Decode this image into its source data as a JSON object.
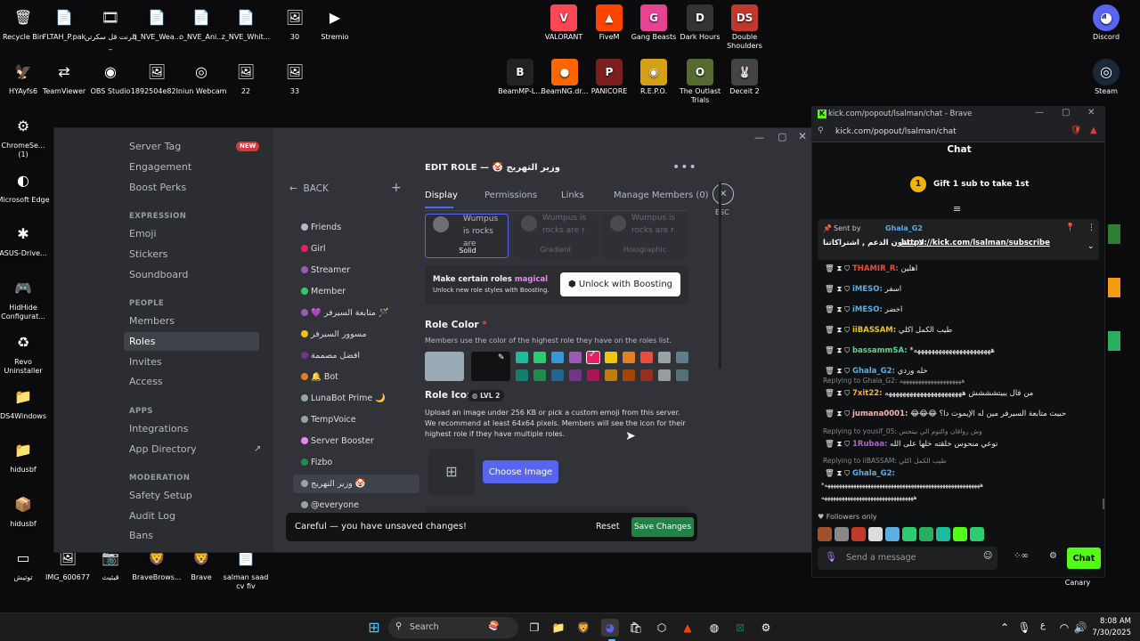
{
  "desktop": {
    "left_icons": [
      {
        "label": "Recycle Bin",
        "glyph": "🗑"
      },
      {
        "label": "FLTAH_P.pak",
        "glyph": "📄"
      },
      {
        "label": "الرنت قل سكرتن _",
        "glyph": "🎞"
      },
      {
        "label": "q_NVE_Wea...",
        "glyph": "📄"
      },
      {
        "label": "o_NVE_Ani...",
        "glyph": "📄"
      },
      {
        "label": "z_NVE_Whit...",
        "glyph": "📄"
      },
      {
        "label": "30",
        "glyph": "🖼"
      },
      {
        "label": "Stremio",
        "glyph": "▶"
      },
      {
        "label": "HYAyfs6",
        "glyph": "🦅"
      },
      {
        "label": "TeamViewer",
        "glyph": "⇄"
      },
      {
        "label": "OBS Studio",
        "glyph": "◉"
      },
      {
        "label": "1892504e82...",
        "glyph": "🖼"
      },
      {
        "label": "Iniun Webcam",
        "glyph": "◎"
      },
      {
        "label": "22",
        "glyph": "🖼"
      },
      {
        "label": "33",
        "glyph": "🖼"
      },
      {
        "label": "ChromeSe... (1)",
        "glyph": "⚙"
      },
      {
        "label": "Microsoft Edge",
        "glyph": "◐"
      },
      {
        "label": "ASUS-Drive...",
        "glyph": "✱"
      },
      {
        "label": "HidHide Configurat...",
        "glyph": "🎮"
      },
      {
        "label": "Revo Uninstaller",
        "glyph": "♻"
      },
      {
        "label": "DS4Windows",
        "glyph": "📁"
      },
      {
        "label": "hidusbf",
        "glyph": "📁"
      },
      {
        "label": "hidusbf",
        "glyph": "📦"
      },
      {
        "label": "توتيش",
        "glyph": "▭"
      },
      {
        "label": "IMG_600677",
        "glyph": "🖼"
      },
      {
        "label": "قيثيث",
        "glyph": "📷"
      },
      {
        "label": "BraveBrows...",
        "glyph": "🦁"
      },
      {
        "label": "Brave",
        "glyph": "🦁"
      },
      {
        "label": "salman saad cv fiv",
        "glyph": "📄"
      }
    ],
    "top_icons": [
      {
        "label": "VALORANT",
        "glyph": "V",
        "color": "#ff4655"
      },
      {
        "label": "FiveM",
        "glyph": "▲",
        "color": "#f40"
      },
      {
        "label": "Gang Beasts",
        "glyph": "G",
        "color": "#e84393"
      },
      {
        "label": "Dark Hours",
        "glyph": "D",
        "color": "#333"
      },
      {
        "label": "Double Shoulders",
        "glyph": "DS",
        "color": "#c0392b"
      },
      {
        "label": "BeamMP-L...",
        "glyph": "B",
        "color": "#222"
      },
      {
        "label": "BeamNG.dr...",
        "glyph": "●",
        "color": "#f60"
      },
      {
        "label": "PANICORE",
        "glyph": "P",
        "color": "#7b1e1e"
      },
      {
        "label": "R.E.P.O.",
        "glyph": "◉",
        "color": "#d4a017"
      },
      {
        "label": "The Outlast Trials",
        "glyph": "O",
        "color": "#556b2f"
      },
      {
        "label": "Deceit 2",
        "glyph": "🐰",
        "color": "#444"
      }
    ],
    "right_icons": [
      {
        "label": "Discord",
        "glyph": "◕"
      },
      {
        "label": "Steam",
        "glyph": "◎"
      },
      {
        "label": "Canary",
        "glyph": ""
      }
    ]
  },
  "discord": {
    "sidebar": {
      "items_top": [
        "Server Tag",
        "Engagement",
        "Boost Perks"
      ],
      "new_badge": "NEW",
      "sections": [
        {
          "header": "EXPRESSION",
          "items": [
            "Emoji",
            "Stickers",
            "Soundboard"
          ]
        },
        {
          "header": "PEOPLE",
          "items": [
            "Members",
            "Roles",
            "Invites",
            "Access"
          ]
        },
        {
          "header": "APPS",
          "items": [
            "Integrations",
            "App Directory"
          ]
        },
        {
          "header": "MODERATION",
          "items": [
            "Safety Setup",
            "Audit Log",
            "Bans"
          ]
        }
      ]
    },
    "roles": {
      "back": "BACK",
      "add": "+",
      "list": [
        {
          "name": "Friends",
          "color": "#b5bac1"
        },
        {
          "name": "Girl",
          "color": "#e91e63"
        },
        {
          "name": "Streamer",
          "color": "#9b59b6"
        },
        {
          "name": "Member",
          "color": "#2ecc71"
        },
        {
          "name": "💜 متابعة السيرفر 🪄",
          "color": "#9b59b6"
        },
        {
          "name": "مسوور السيرفر",
          "color": "#f1c40f"
        },
        {
          "name": "افضل مصممة",
          "color": "#71368a"
        },
        {
          "name": "🔔 Bot",
          "color": "#e67e22"
        },
        {
          "name": "LunaBot Prime 🌙",
          "color": "#95a5a6"
        },
        {
          "name": "TempVoice",
          "color": "#95a5a6"
        },
        {
          "name": "Server Booster",
          "color": "#f47fff"
        },
        {
          "name": "Fizbo",
          "color": "#1f8b4c"
        },
        {
          "name": "وزير التهريج 🤡",
          "color": "#95a5a6"
        },
        {
          "name": "@everyone",
          "color": "#95a5a6"
        }
      ]
    },
    "edit": {
      "title": "EDIT ROLE — 🤡 وزير التهريج",
      "tabs": [
        "Display",
        "Permissions",
        "Links",
        "Manage Members (0)"
      ],
      "close_label": "ESC",
      "styles": [
        {
          "label": "Solid",
          "preview": "Wumpus is rocks are"
        },
        {
          "label": "Gradient",
          "preview": "Wumpus is rocks are r"
        },
        {
          "label": "Holographic",
          "preview": "Wumpus is rocks are r"
        }
      ],
      "boost_title": "Make certain roles",
      "boost_title_accent": "magical",
      "boost_sub": "Unlock new role styles with Boosting.",
      "boost_button": "Unlock with Boosting",
      "role_color_label": "Role Color",
      "role_color_required": "*",
      "role_color_desc": "Members use the color of the highest role they have on the roles list.",
      "default_color": "#99aab5",
      "palette_top": [
        "#1abc9c",
        "#2ecc71",
        "#3498db",
        "#9b59b6",
        "#e91e63",
        "#f1c40f",
        "#e67e22",
        "#e74c3c",
        "#95a5a6",
        "#607d8b"
      ],
      "palette_bottom": [
        "#11806a",
        "#1f8b4c",
        "#206694",
        "#71368a",
        "#ad1457",
        "#c27c0e",
        "#a84300",
        "#992d22",
        "#979c9f",
        "#546e7a"
      ],
      "role_icon_label": "Role Icon",
      "lvl_badge": "LVL 2",
      "role_icon_desc": "Upload an image under 256 KB or pick a custom emoji from this server. We recommend at least 64x64 pixels. Members will see the icon for their highest role if they have multiple roles.",
      "choose_image": "Choose Image",
      "unsaved": "Careful — you have unsaved changes!",
      "reset": "Reset",
      "save": "Save Changes"
    }
  },
  "kick": {
    "window_title": "kick.com/popout/lsalman/chat - Brave",
    "url": "kick.com/popout/lsalman/chat",
    "header": "Chat",
    "gift_count": "1",
    "gift_text": "Gift 1 sub to take 1st",
    "pinned_sent_by": "Sent by",
    "pinned_user": "Ghala_G2",
    "pinned_text": "لا تنسون الدعم , اشتراكاتنا",
    "pinned_link": "https://kick.com/lsalman/subscribe",
    "messages": [
      {
        "user": "THAMIR_R:",
        "color": "#e74c3c",
        "text": "اهلين"
      },
      {
        "user": "iMESO:",
        "color": "#5dade2",
        "text": "اسفر"
      },
      {
        "user": "iMESO:",
        "color": "#5dade2",
        "text": "اخضر"
      },
      {
        "user": "iiBASSAM:",
        "color": "#f1c40f",
        "text": "طيب الكمل اكلي"
      },
      {
        "user": "bassammSA:",
        "color": "#58d68d",
        "text": "*ههههههههههههههههههههههه"
      },
      {
        "user": "Ghala_G2:",
        "color": "#5dade2",
        "text": "خله وردي"
      }
    ],
    "reply1": "Replying to Ghala_G2: ههههههههههههههههههههه",
    "msg7": {
      "user": "7xit22:",
      "color": "#f5b041",
      "text": "من قال يبيتشششش ههههههههههههههههههههههه"
    },
    "msg8": {
      "user": "jumana0001:",
      "color": "#f5b7b1",
      "text": "😂😂😂 حبيت متابعة السيرفر مين له الإيموت دا؟"
    },
    "reply2": "Replying to yousif_05: وش رواقان والتوم الي بيتحس",
    "msg9": {
      "user": "1Rubaa:",
      "color": "#a569bd",
      "text": "توعي منحوس خلقته خلها على الله"
    },
    "reply3": "Replying to iiBASSAM: طيب الكمل اكلي",
    "msg10": {
      "user": "Ghala_G2:",
      "color": "#5dade2",
      "text": ""
    },
    "long_text": "*ههههههههههههههههههههههههههههههههههههههههههههههههههههههه",
    "long_text2": "ههههههههههههههههههههههههههههههههه",
    "followers_only": "Followers only",
    "input_placeholder": "Send a message",
    "chat_button": "Chat"
  },
  "taskbar": {
    "search": "Search",
    "time": "8:08 AM",
    "date": "7/30/2025",
    "lang": "ع"
  }
}
